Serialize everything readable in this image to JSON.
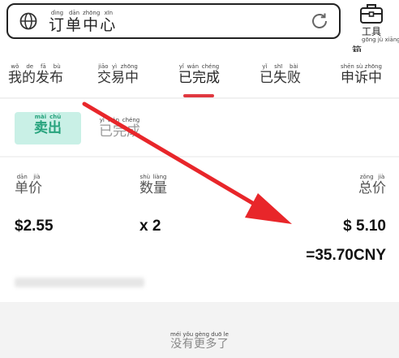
{
  "header": {
    "title_chars": [
      {
        "hanzi": "订",
        "pinyin": "dìng"
      },
      {
        "hanzi": "单",
        "pinyin": "dān"
      },
      {
        "hanzi": "中",
        "pinyin": "zhōng"
      },
      {
        "hanzi": "心",
        "pinyin": "xīn"
      }
    ],
    "toolbox_label": "工具箱",
    "toolbox_pinyin": "gōng jù xiāng"
  },
  "tabs": [
    {
      "label": "我的发布",
      "pinyin": "wǒ de fā bù"
    },
    {
      "label": "交易中",
      "pinyin": "jiāo yì zhōng"
    },
    {
      "label": "已完成",
      "pinyin": "yǐ wán chéng",
      "active": true
    },
    {
      "label": "已失败",
      "pinyin": "yǐ shī bài"
    },
    {
      "label": "申诉中",
      "pinyin": "shēn sù zhōng"
    }
  ],
  "filter": {
    "sell_label": "卖出",
    "sell_pinyin": "mài chū",
    "done_label": "已完成",
    "done_pinyin": "yǐ wán chéng"
  },
  "order": {
    "unit_price_label": "单价",
    "unit_price_pinyin": "dān jià",
    "quantity_label": "数量",
    "quantity_pinyin": "shù liàng",
    "total_label": "总价",
    "total_pinyin": "zǒng jià",
    "unit_price": "$2.55",
    "quantity": "x 2",
    "total": "$ 5.10",
    "total_cny": "=35.70CNY"
  },
  "footer": {
    "text": "没有更多了",
    "pinyin": "méi yǒu gèng duō le"
  },
  "colors": {
    "accent_red": "#e0383f",
    "sell_bg": "#c9f0e6",
    "sell_text": "#27a37d",
    "arrow_red": "#e8262a"
  },
  "icons": [
    "globe-icon",
    "refresh-icon",
    "toolbox-icon"
  ]
}
